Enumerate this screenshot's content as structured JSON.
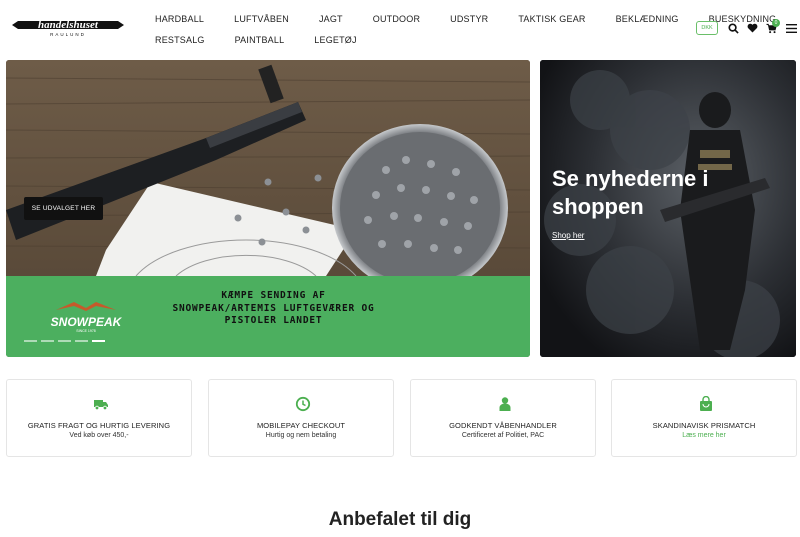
{
  "header": {
    "logo_text": "handelshuset",
    "logo_sub": "RAULUND",
    "nav_row1": [
      "HARDBALL",
      "LUFTVÅBEN",
      "JAGT",
      "OUTDOOR",
      "UDSTYR",
      "TAKTISK GEAR",
      "BEKLÆDNING",
      "BUESKYDNING"
    ],
    "nav_row2": [
      "RESTSALG",
      "PAINTBALL",
      "LEGETØJ"
    ],
    "currency": "DKK",
    "cart_count": "0"
  },
  "hero_left": {
    "cta_label": "SE UDVALGET HER",
    "brand": "SNOWPEAK",
    "brand_sub": "SINCE 1978",
    "banner_text": "KÆMPE SENDING AF SNOWPEAK/ARTEMIS LUFTGEVÆRER OG PISTOLER LANDET",
    "slides": 5,
    "active_slide": 5
  },
  "hero_right": {
    "title": "Se nyhederne i shoppen",
    "link_label": "Shop her"
  },
  "usps": [
    {
      "icon": "truck-icon",
      "title": "GRATIS FRAGT OG HURTIG LEVERING",
      "subtitle": "Ved køb over 450,-"
    },
    {
      "icon": "clock-icon",
      "title": "MOBILEPAY CHECKOUT",
      "subtitle": "Hurtig og nem betaling"
    },
    {
      "icon": "user-icon",
      "title": "GODKENDT VÅBENHANDLER",
      "subtitle": "Certificeret af Politiet, PAC"
    },
    {
      "icon": "shopping-bag-icon",
      "title": "SKANDINAVISK PRISMATCH",
      "subtitle": "Læs mere her"
    }
  ],
  "section": {
    "title": "Anbefalet til dig"
  },
  "colors": {
    "accent": "#4caf50",
    "band": "#4caf5f",
    "dark": "#111111"
  }
}
